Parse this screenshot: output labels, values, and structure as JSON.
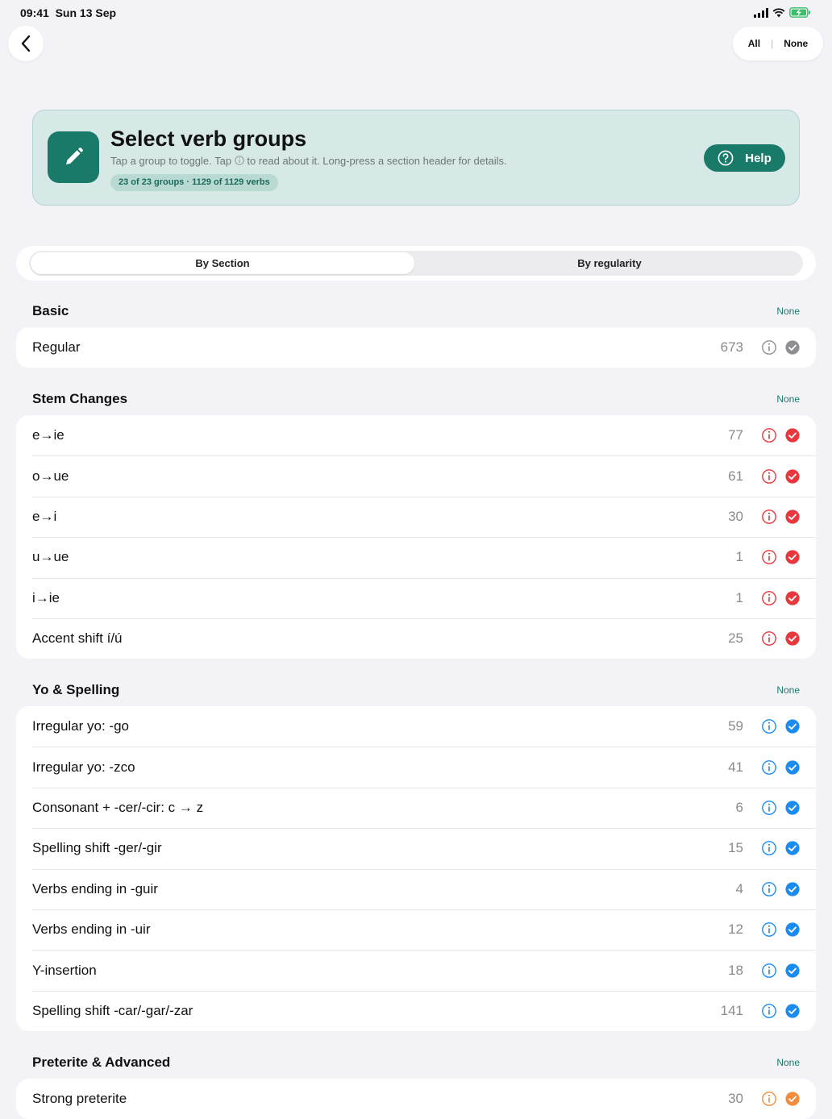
{
  "status": {
    "time": "09:41",
    "date": "Sun 13 Sep"
  },
  "toolbar": {
    "all_label": "All",
    "none_label": "None"
  },
  "header": {
    "title": "Select verb groups",
    "subtitle_pre": "Tap a group to toggle. Tap",
    "subtitle_post": "to read about it. Long-press a section header for details.",
    "summary": "23 of 23 groups · 1129 of 1129 verbs",
    "help_label": "Help"
  },
  "segments": {
    "by_section": "By Section",
    "by_regularity": "By regularity",
    "selected": "By Section"
  },
  "colors": {
    "accent": "#1a7a6a",
    "basic": "#8e8e93",
    "stem": "#e8383d",
    "yo": "#1a8cf0",
    "preterite": "#f08c3c"
  },
  "sections": [
    {
      "title": "Basic",
      "none_label": "None",
      "color_key": "basic",
      "rows": [
        {
          "label": "Regular",
          "count": "673"
        }
      ]
    },
    {
      "title": "Stem Changes",
      "none_label": "None",
      "color_key": "stem",
      "rows": [
        {
          "label": "e→ie",
          "count": "77"
        },
        {
          "label": "o→ue",
          "count": "61"
        },
        {
          "label": "e→i",
          "count": "30"
        },
        {
          "label": "u→ue",
          "count": "1"
        },
        {
          "label": "i→ie",
          "count": "1"
        },
        {
          "label": "Accent shift í/ú",
          "count": "25"
        }
      ]
    },
    {
      "title": "Yo & Spelling",
      "none_label": "None",
      "color_key": "yo",
      "rows": [
        {
          "label": "Irregular yo: -go",
          "count": "59"
        },
        {
          "label": "Irregular yo: -zco",
          "count": "41"
        },
        {
          "label": "Consonant + -cer/-cir: c → z",
          "count": "6"
        },
        {
          "label": "Spelling shift -ger/-gir",
          "count": "15"
        },
        {
          "label": "Verbs ending in -guir",
          "count": "4"
        },
        {
          "label": "Verbs ending in -uir",
          "count": "12"
        },
        {
          "label": "Y-insertion",
          "count": "18"
        },
        {
          "label": "Spelling shift -car/-gar/-zar",
          "count": "141"
        }
      ]
    },
    {
      "title": "Preterite & Advanced",
      "none_label": "None",
      "color_key": "preterite",
      "rows": [
        {
          "label": "Strong preterite",
          "count": "30"
        }
      ]
    }
  ]
}
